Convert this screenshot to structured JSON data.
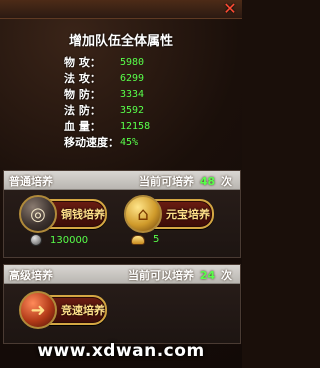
{
  "header": {
    "close_glyph": "✕"
  },
  "title": "增加队伍全体属性",
  "stats": [
    {
      "label": "物  攻：",
      "value": "5980"
    },
    {
      "label": "法  攻：",
      "value": "6299"
    },
    {
      "label": "物  防：",
      "value": "3334"
    },
    {
      "label": "法  防：",
      "value": "3592"
    },
    {
      "label": "血  量：",
      "value": "12158"
    },
    {
      "label": "移动速度：",
      "value": "45%"
    }
  ],
  "normal_training": {
    "title": "普通培养",
    "remaining_prefix": "当前可培养",
    "remaining_count": "48",
    "remaining_suffix": "次",
    "copper_button_label": "铜钱培养",
    "yuanbao_button_label": "元宝培养",
    "copper_cost": "130000",
    "yuanbao_cost": "5"
  },
  "advanced_training": {
    "title": "高级培养",
    "remaining_prefix": "当前可以培养",
    "remaining_count": "24",
    "remaining_suffix": "次",
    "fast_button_label": "竞速培养"
  },
  "watermark": "www.xdwan.com",
  "icons": {
    "close": "close-icon",
    "copper": "copper-coin-icon",
    "yuanbao": "yuanbao-ingot-icon",
    "fast": "fast-training-icon"
  },
  "colors": {
    "value_green": "#58ff4a",
    "button_gold": "#d4a743",
    "close_red": "#ff4b34"
  }
}
